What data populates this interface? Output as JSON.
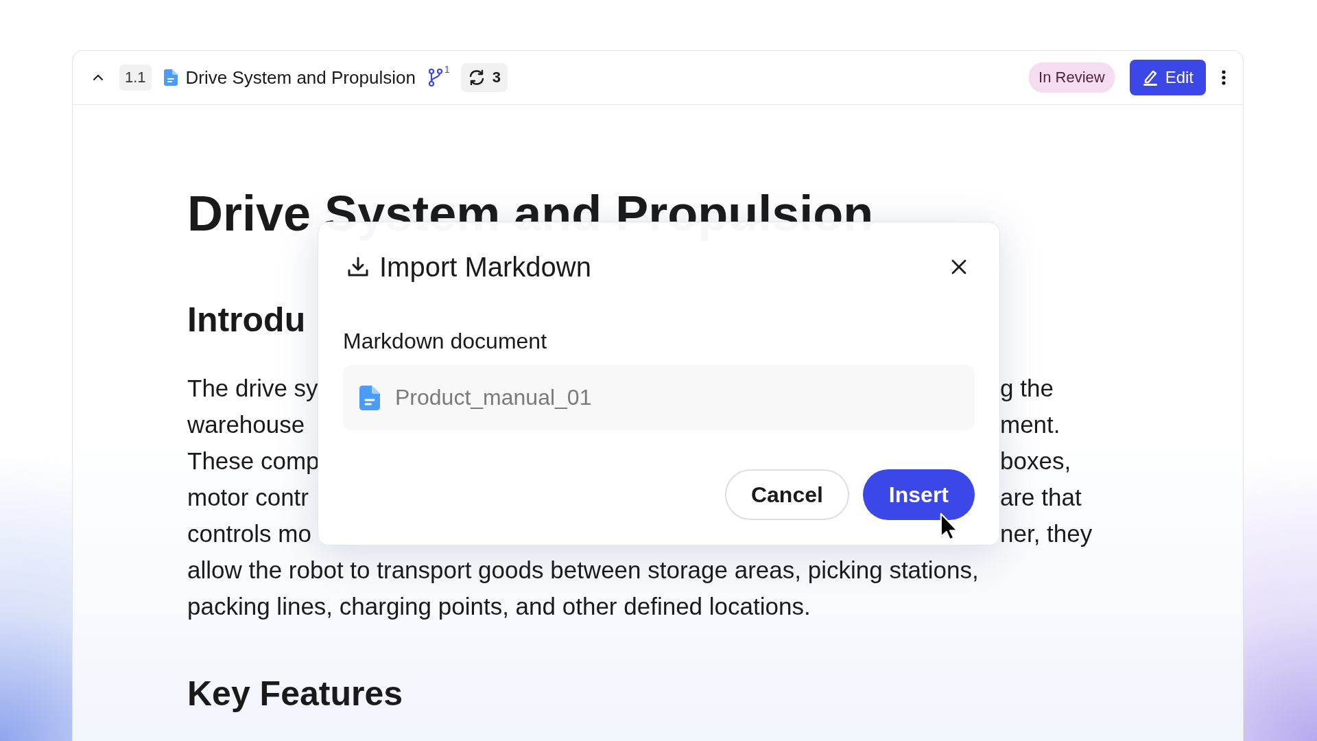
{
  "header": {
    "section_number": "1.1",
    "title": "Drive System and Propulsion",
    "branch_count": "1",
    "sync_count": "3",
    "status": "In Review",
    "edit_button": "Edit"
  },
  "document": {
    "title": "Drive System and Propulsion",
    "heading_1": "Introdu",
    "paragraph_lines": [
      {
        "kind": "split",
        "left": "The drive sy",
        "right": "g the"
      },
      {
        "kind": "split",
        "left": "warehouse",
        "right": "ment."
      },
      {
        "kind": "split",
        "left": "These comp",
        "right": "boxes,"
      },
      {
        "kind": "split",
        "left": "motor contr",
        "right": "are that"
      },
      {
        "kind": "split",
        "left": "controls mo",
        "right": "ner, they"
      },
      {
        "kind": "full",
        "text": "allow the robot to transport goods between storage areas, picking stations,"
      },
      {
        "kind": "full",
        "text": "packing lines, charging points, and other defined locations."
      }
    ],
    "heading_2": "Key Features"
  },
  "dialog": {
    "title": "Import Markdown",
    "field_label": "Markdown document",
    "file_name": "Product_manual_01",
    "buttons": [
      {
        "label": "Cancel",
        "kind": "secondary"
      },
      {
        "label": "Insert",
        "kind": "primary"
      }
    ]
  }
}
